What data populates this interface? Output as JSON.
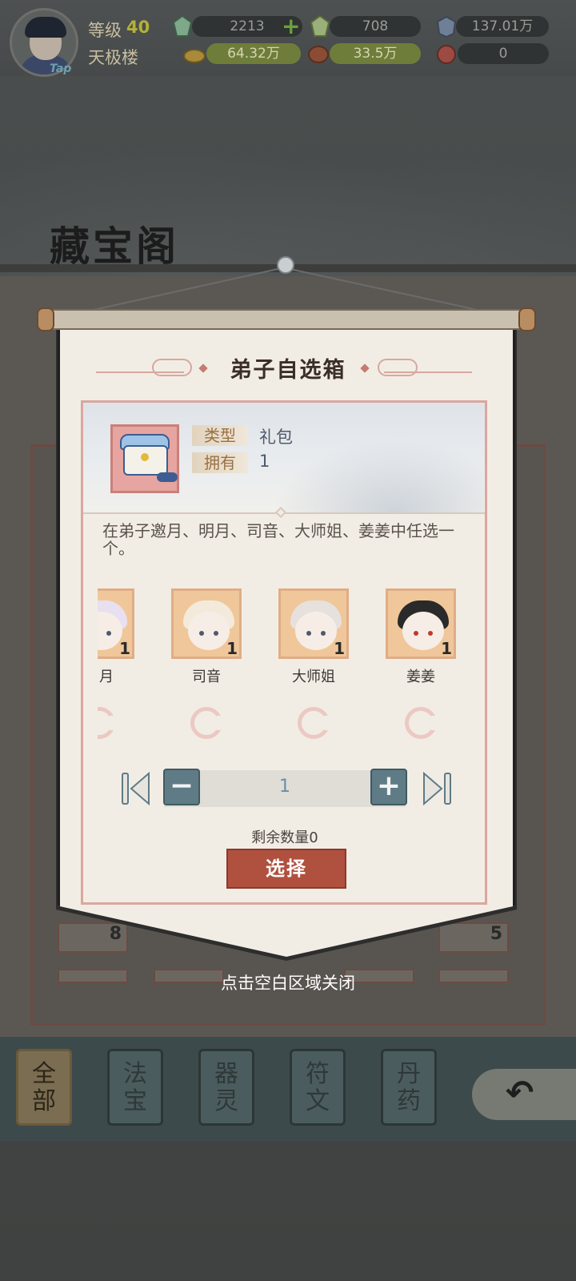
{
  "hud": {
    "level_label": "等级",
    "level": "40",
    "player_name": "天极楼",
    "avatar_tag": "Tap",
    "resources": [
      {
        "icon": "spirit-stone-icon",
        "value": "2213",
        "has_plus": true
      },
      {
        "icon": "rainbow-crystal-icon",
        "value": "708"
      },
      {
        "icon": "blue-gem-icon",
        "value": "137.01万"
      },
      {
        "icon": "gold-ingot-icon",
        "value": "64.32万"
      },
      {
        "icon": "meat-icon",
        "value": "33.5万"
      },
      {
        "icon": "red-token-icon",
        "value": "0"
      }
    ],
    "plus_symbol": "+"
  },
  "page": {
    "title": "藏宝阁"
  },
  "background_cards": [
    "8",
    "5"
  ],
  "dialog": {
    "title": "弟子自选箱",
    "type_label": "类型",
    "type_value": "礼包",
    "own_label": "拥有",
    "own_value": "1",
    "description": "在弟子邀月、明月、司音、大师姐、姜姜中任选一个。",
    "heroes": [
      {
        "name": "明月",
        "visible_name": "月",
        "count": "1",
        "hair_color": "#e8e0f0"
      },
      {
        "name": "司音",
        "count": "1",
        "hair_color": "#f3eadb"
      },
      {
        "name": "大师姐",
        "count": "1",
        "hair_color": "#e7e1dd"
      },
      {
        "name": "姜姜",
        "count": "1",
        "hair_color": "#2a2a2a"
      }
    ],
    "quantity": "1",
    "minus_symbol": "−",
    "plus_symbol": "+",
    "remaining_text": "剩余数量0",
    "select_button": "选择",
    "close_hint": "点击空白区域关闭"
  },
  "tabs": [
    {
      "label": "全部",
      "active": true
    },
    {
      "label": "法宝",
      "active": false
    },
    {
      "label": "器灵",
      "active": false
    },
    {
      "label": "符文",
      "active": false
    },
    {
      "label": "丹药",
      "active": false
    }
  ],
  "back_symbol": "↶",
  "colors": {
    "accent_red": "#b0503f",
    "qty_blue": "#5f7b86",
    "paper": "#f2ede4"
  }
}
